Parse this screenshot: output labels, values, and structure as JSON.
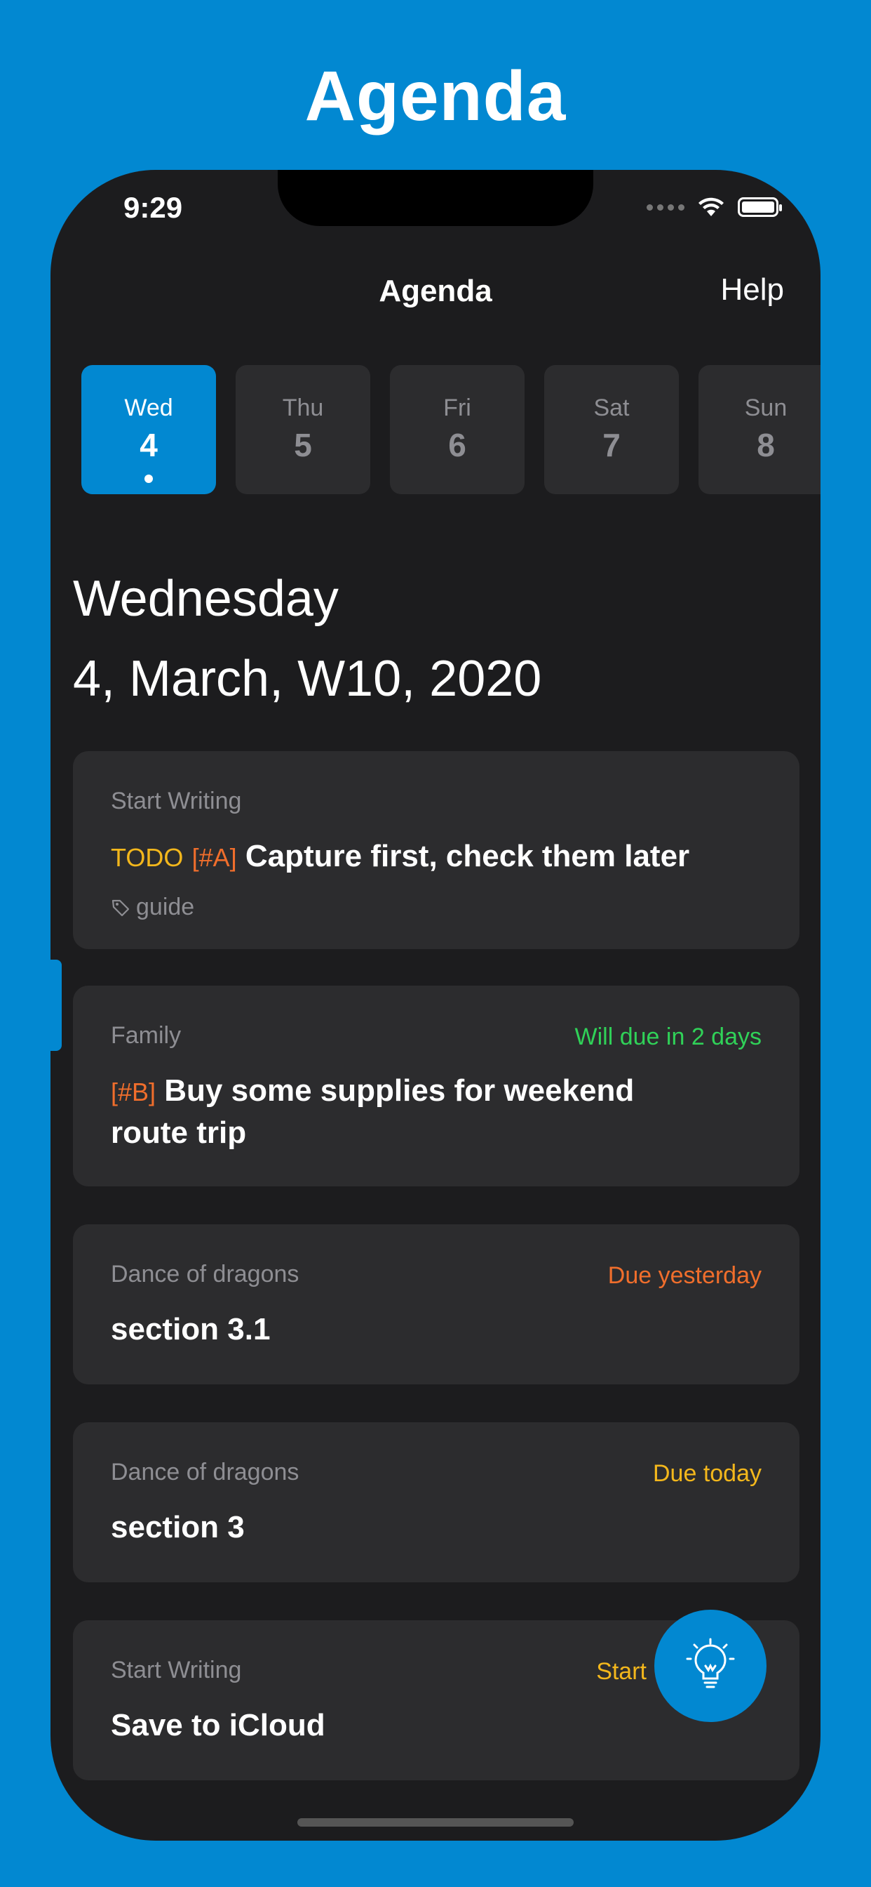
{
  "promo": {
    "title": "Agenda"
  },
  "status": {
    "time": "9:29"
  },
  "nav": {
    "title": "Agenda",
    "help": "Help"
  },
  "days": [
    {
      "name": "Wed",
      "num": "4",
      "active": true
    },
    {
      "name": "Thu",
      "num": "5"
    },
    {
      "name": "Fri",
      "num": "6"
    },
    {
      "name": "Sat",
      "num": "7"
    },
    {
      "name": "Sun",
      "num": "8"
    }
  ],
  "date": {
    "weekday": "Wednesday",
    "full": "4, March,  W10, 2020"
  },
  "cards": [
    {
      "list": "Start Writing",
      "keyword": "TODO",
      "priority": "[#A]",
      "title": "Capture first, check them later",
      "tag": "guide"
    },
    {
      "list": "Family",
      "due": "Will due in 2 days",
      "priority": "[#B]",
      "title": "Buy some supplies for weekend route trip"
    },
    {
      "list": "Dance of dragons",
      "due": "Due yesterday",
      "title": "section 3.1"
    },
    {
      "list": "Dance of dragons",
      "due": "Due today",
      "title": "section  3"
    },
    {
      "list": "Start Writing",
      "due": "Start",
      "title": "Save to iCloud"
    }
  ],
  "colors": {
    "accent": "#0288d1",
    "due_soon": "#30d158",
    "due_overdue": "#f06e2c",
    "due_today": "#f3b71c",
    "start": "#f3b71c"
  },
  "icons": {
    "fab": "lightbulb-icon",
    "tag": "tag-icon"
  }
}
